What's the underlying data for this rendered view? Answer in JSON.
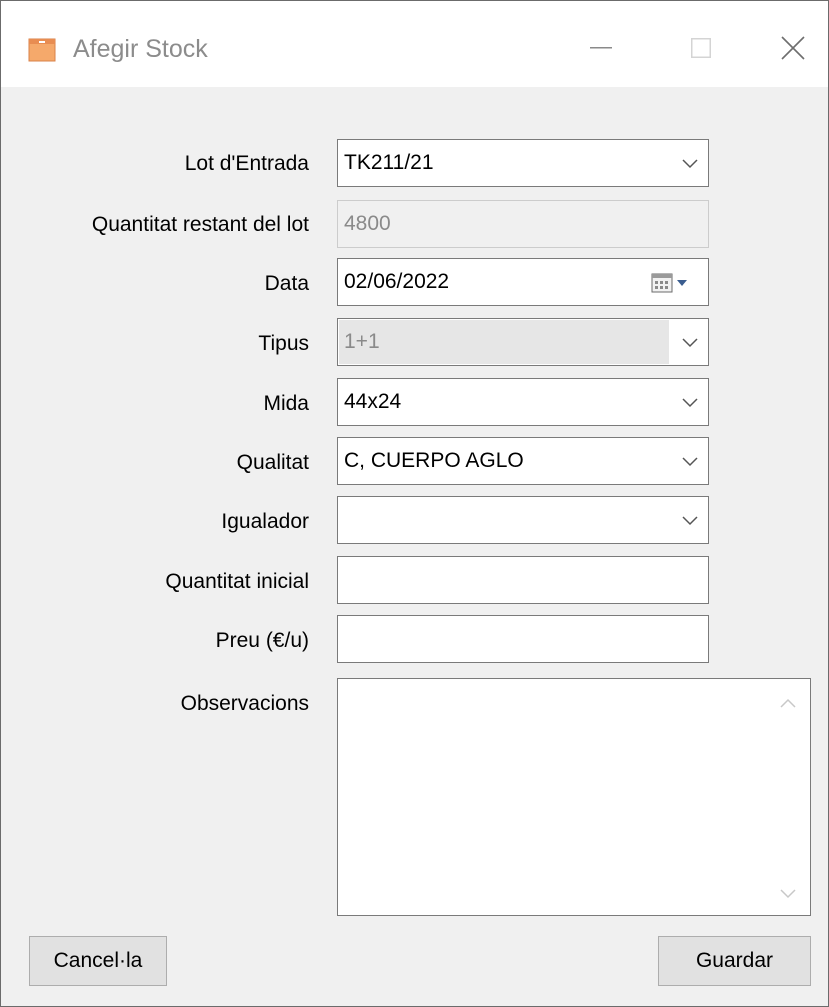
{
  "window": {
    "title": "Afegir Stock",
    "app_icon": "box-icon",
    "controls": [
      "minimize-icon",
      "maximize-icon",
      "close-icon"
    ]
  },
  "form": {
    "lot_entrada": {
      "label": "Lot d'Entrada",
      "value": "TK211/21"
    },
    "quantitat_restant": {
      "label": "Quantitat restant del lot",
      "value": "4800"
    },
    "data": {
      "label": "Data",
      "value": "02/06/2022"
    },
    "tipus": {
      "label": "Tipus",
      "value": "1+1"
    },
    "mida": {
      "label": "Mida",
      "value": "44x24"
    },
    "qualitat": {
      "label": "Qualitat",
      "value": "C, CUERPO AGLO"
    },
    "igualador": {
      "label": "Igualador",
      "value": ""
    },
    "quantitat_inicial": {
      "label": "Quantitat inicial",
      "value": ""
    },
    "preu": {
      "label": "Preu (€/u)",
      "value": ""
    },
    "observacions": {
      "label": "Observacions",
      "value": ""
    }
  },
  "buttons": {
    "cancel": "Cancel·la",
    "save": "Guardar"
  }
}
